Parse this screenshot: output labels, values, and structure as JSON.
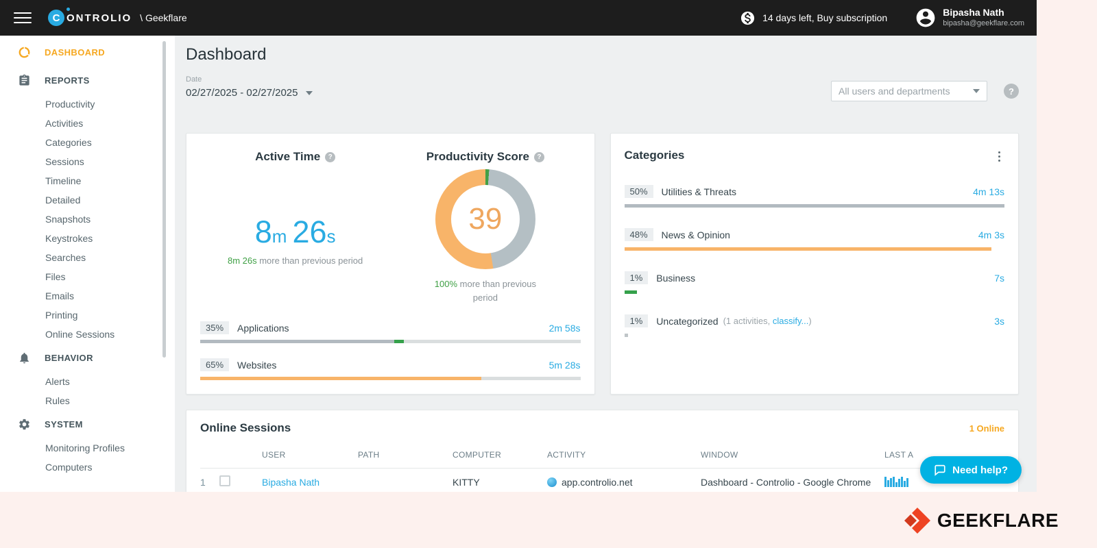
{
  "topbar": {
    "logo_letter": "C",
    "logo_text": "ONTROLIO",
    "workspace": "\\ Geekflare",
    "subscription": "14 days left, Buy subscription",
    "user_name": "Bipasha Nath",
    "user_email": "bipasha@geekflare.com"
  },
  "sidebar": {
    "dashboard_label": "DASHBOARD",
    "reports_label": "REPORTS",
    "reports": [
      "Productivity",
      "Activities",
      "Categories",
      "Sessions",
      "Timeline",
      "Detailed",
      "Snapshots",
      "Keystrokes",
      "Searches",
      "Files",
      "Emails",
      "Printing",
      "Online Sessions"
    ],
    "behavior_label": "BEHAVIOR",
    "behavior": [
      "Alerts",
      "Rules"
    ],
    "system_label": "SYSTEM",
    "system": [
      "Monitoring Profiles",
      "Computers"
    ]
  },
  "header": {
    "title": "Dashboard",
    "date_label": "Date",
    "date_value": "02/27/2025 - 02/27/2025",
    "users_filter": "All users and departments",
    "help_glyph": "?"
  },
  "active_time": {
    "title": "Active Time",
    "score_title": "Productivity Score",
    "time_min": "8",
    "time_min_unit": "m",
    "time_sec": "26",
    "time_sec_unit": "s",
    "delta_highlight": "8m 26s",
    "delta_rest": " more than previous period",
    "score_value": "39",
    "score_delta_highlight": "100%",
    "score_delta_rest": " more than previous period",
    "rows": [
      {
        "percent": "35%",
        "label": "Applications",
        "time": "2m 58s"
      },
      {
        "percent": "65%",
        "label": "Websites",
        "time": "5m 28s"
      }
    ]
  },
  "categories": {
    "title": "Categories",
    "rows": [
      {
        "percent": "50%",
        "label": "Utilities & Threats",
        "time": "4m 13s"
      },
      {
        "percent": "48%",
        "label": "News & Opinion",
        "time": "4m 3s"
      },
      {
        "percent": "1%",
        "label": "Business",
        "time": "7s"
      },
      {
        "percent": "1%",
        "label": "Uncategorized",
        "note_prefix": "(1 activities, ",
        "note_link": "classify...",
        "note_suffix": ")",
        "time": "3s"
      }
    ]
  },
  "online_sessions": {
    "title": "Online Sessions",
    "status": "1 Online",
    "headers": [
      "USER",
      "PATH",
      "COMPUTER",
      "ACTIVITY",
      "WINDOW",
      "LAST A"
    ],
    "rows": [
      {
        "num": "1",
        "user": "Bipasha Nath",
        "path": "",
        "computer": "KITTY",
        "activity": "app.controlio.net",
        "window": "Dashboard - Controlio - Google Chrome"
      }
    ]
  },
  "need_help": {
    "label": "Need help?"
  },
  "footer": {
    "brand": "GEEKFLARE"
  },
  "colors": {
    "accent_orange": "#f6a821",
    "brand_blue": "#29abe2",
    "positive_green": "#43a047",
    "neutral_gray": "#b4bfc4",
    "help_cyan": "#00b2e3",
    "geekflare_red": "#ee4323"
  }
}
